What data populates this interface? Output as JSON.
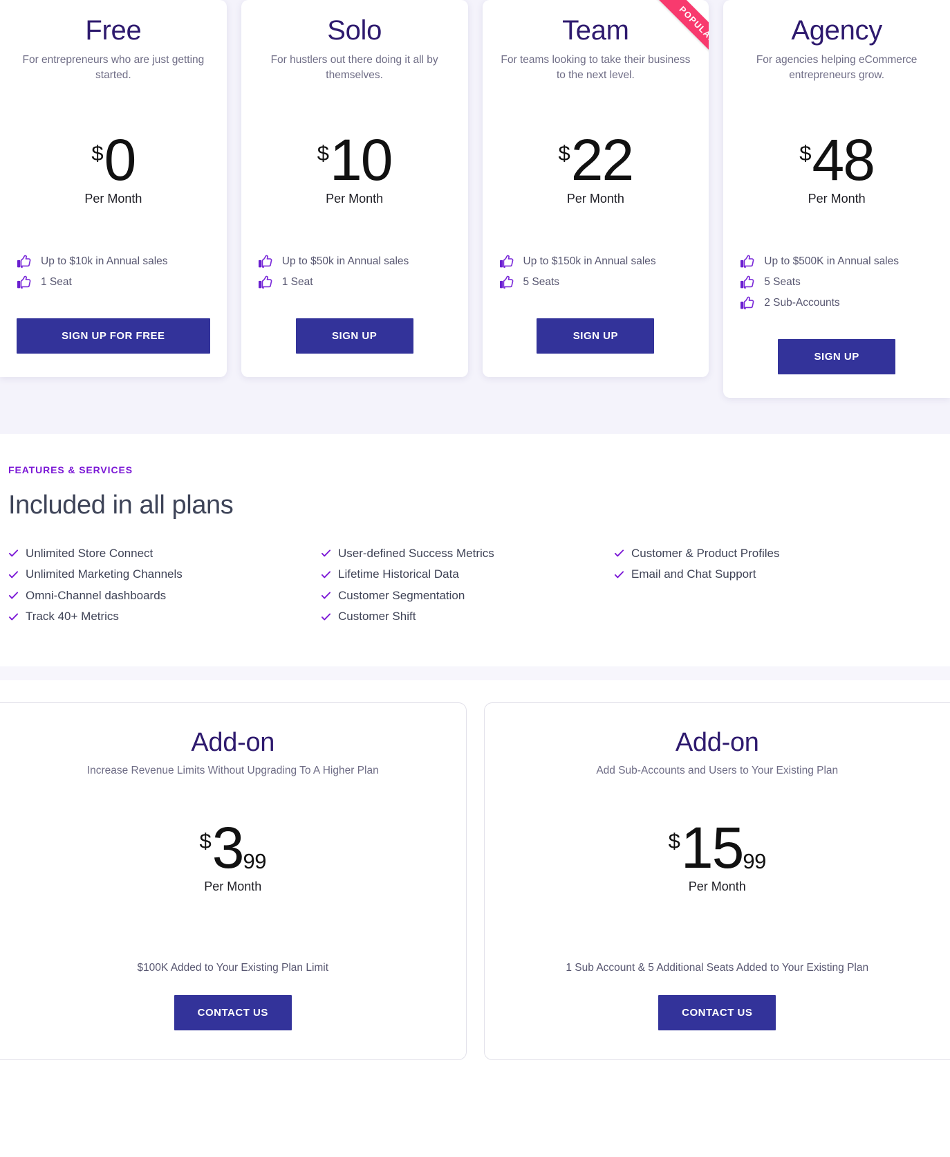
{
  "theme": {
    "accent_purple": "#7b18d6",
    "heading_purple": "#2e1a6e",
    "button_indigo": "#33339a",
    "ribbon_pink": "#f83a6e",
    "section_tint": "#f4f3fb"
  },
  "plans": [
    {
      "name": "Free",
      "tagline": "For entrepreneurs who are just getting started.",
      "currency": "$",
      "amount": "0",
      "cents": "",
      "period": "Per Month",
      "features": [
        "Up to $10k in Annual sales",
        "1 Seat"
      ],
      "cta": "SIGN UP FOR FREE",
      "badge": ""
    },
    {
      "name": "Solo",
      "tagline": "For hustlers out there doing it all by themselves.",
      "currency": "$",
      "amount": "10",
      "cents": "",
      "period": "Per Month",
      "features": [
        "Up to $50k in Annual sales",
        "1 Seat"
      ],
      "cta": "SIGN UP",
      "badge": ""
    },
    {
      "name": "Team",
      "tagline": "For teams looking to take their business to the next level.",
      "currency": "$",
      "amount": "22",
      "cents": "",
      "period": "Per Month",
      "features": [
        "Up to $150k in Annual sales",
        "5 Seats"
      ],
      "cta": "SIGN UP",
      "badge": "POPULAR"
    },
    {
      "name": "Agency",
      "tagline": "For agencies helping eCommerce entrepreneurs grow.",
      "currency": "$",
      "amount": "48",
      "cents": "",
      "period": "Per Month",
      "features": [
        "Up to $500K in Annual sales",
        "5 Seats",
        "2 Sub-Accounts"
      ],
      "cta": "SIGN UP",
      "badge": ""
    }
  ],
  "features_section": {
    "eyebrow": "FEATURES & SERVICES",
    "title": "Included in all plans",
    "columns": [
      [
        "Unlimited Store Connect",
        "Unlimited Marketing Channels",
        "Omni-Channel dashboards",
        "Track 40+ Metrics"
      ],
      [
        "User-defined Success Metrics",
        "Lifetime Historical Data",
        "Customer Segmentation",
        "Customer Shift"
      ],
      [
        "Customer & Product Profiles",
        "Email and Chat Support"
      ]
    ]
  },
  "addons": [
    {
      "name": "Add-on",
      "tagline": "Increase Revenue Limits Without Upgrading To A Higher Plan",
      "currency": "$",
      "amount": "3",
      "cents": "99",
      "period": "Per Month",
      "note": "$100K Added to Your Existing Plan Limit",
      "cta": "CONTACT US"
    },
    {
      "name": "Add-on",
      "tagline": "Add Sub-Accounts and Users to Your Existing Plan",
      "currency": "$",
      "amount": "15",
      "cents": "99",
      "period": "Per Month",
      "note": "1 Sub Account & 5 Additional Seats Added to Your Existing Plan",
      "cta": "CONTACT US"
    }
  ]
}
